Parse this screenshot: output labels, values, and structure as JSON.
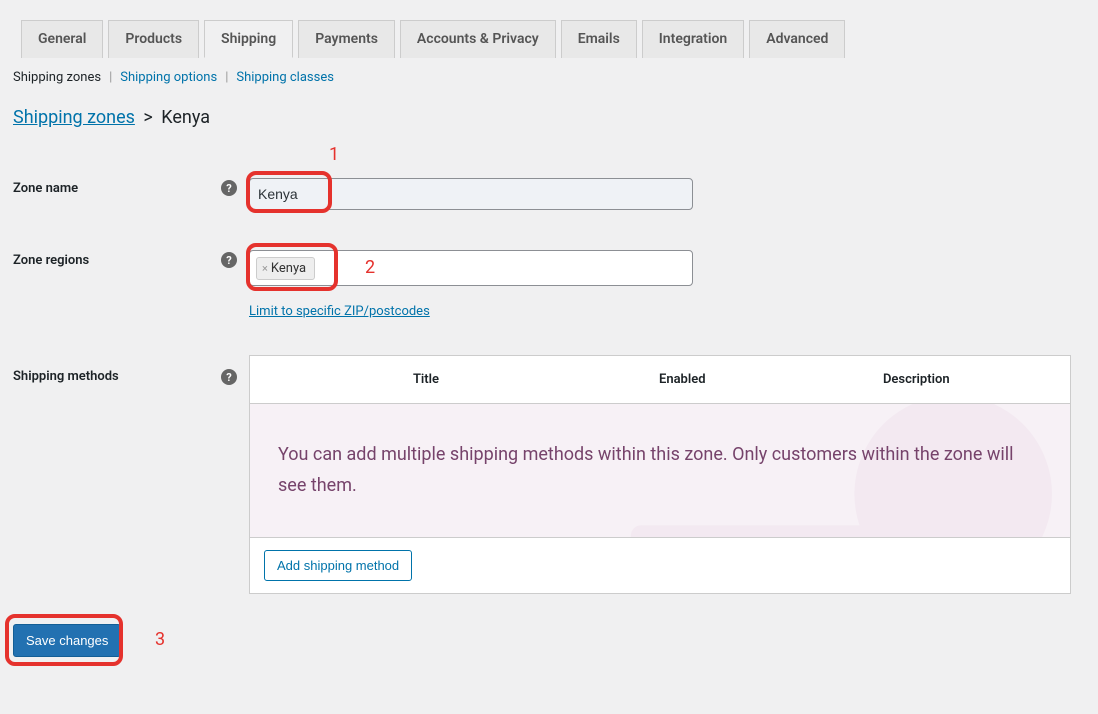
{
  "tabs": {
    "general": "General",
    "products": "Products",
    "shipping": "Shipping",
    "payments": "Payments",
    "accounts": "Accounts & Privacy",
    "emails": "Emails",
    "integration": "Integration",
    "advanced": "Advanced"
  },
  "subtabs": {
    "zones": "Shipping zones",
    "options": "Shipping options",
    "classes": "Shipping classes"
  },
  "breadcrumb": {
    "zones": "Shipping zones",
    "sep": ">",
    "current": "Kenya"
  },
  "labels": {
    "zone_name": "Zone name",
    "zone_regions": "Zone regions",
    "shipping_methods": "Shipping methods"
  },
  "fields": {
    "zone_name_value": "Kenya",
    "region_tag": "Kenya",
    "postcode_link": "Limit to specific ZIP/postcodes"
  },
  "annotations": {
    "one": "1",
    "two": "2",
    "three": "3"
  },
  "methods": {
    "header_title": "Title",
    "header_enabled": "Enabled",
    "header_description": "Description",
    "empty": "You can add multiple shipping methods within this zone. Only customers within the zone will see them.",
    "add_button": "Add shipping method"
  },
  "save": "Save changes",
  "help_glyph": "?",
  "tag_x": "×",
  "subtab_sep": "|"
}
